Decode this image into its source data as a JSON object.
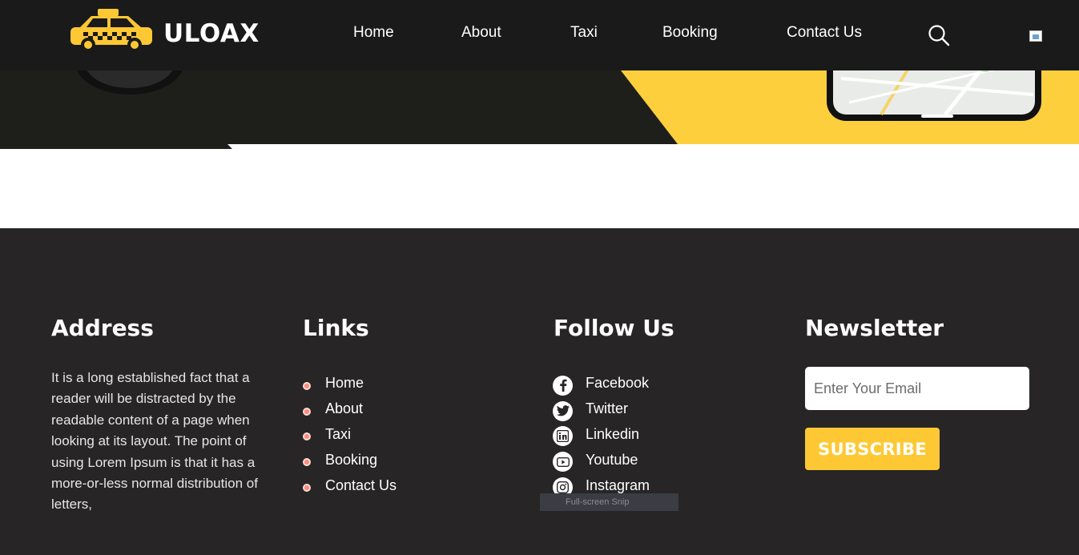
{
  "brand": {
    "name": "ULOAX",
    "logo_icon": "taxi-car-icon",
    "accent_color": "#fdc834"
  },
  "nav": {
    "items": [
      "Home",
      "About",
      "Taxi",
      "Booking",
      "Contact Us"
    ],
    "search_icon": "search-icon"
  },
  "footer": {
    "address": {
      "title": "Address",
      "text": "It is a long established fact that a reader will be distracted by the readable content of a page when looking at its layout. The point of using Lorem Ipsum is that it has a more-or-less normal distribution of letters,"
    },
    "links": {
      "title": "Links",
      "items": [
        "Home",
        "About",
        "Taxi",
        "Booking",
        "Contact Us"
      ]
    },
    "follow": {
      "title": "Follow Us",
      "items": [
        {
          "label": "Facebook",
          "icon": "facebook-icon"
        },
        {
          "label": "Twitter",
          "icon": "twitter-icon"
        },
        {
          "label": "Linkedin",
          "icon": "linkedin-icon"
        },
        {
          "label": "Youtube",
          "icon": "youtube-icon"
        },
        {
          "label": "Instagram",
          "icon": "instagram-icon"
        }
      ]
    },
    "newsletter": {
      "title": "Newsletter",
      "email_placeholder": "Enter Your Email",
      "email_value": "",
      "subscribe_label": "SUBSCRIBE"
    }
  },
  "overlay": {
    "snip_tooltip": "Full-screen Snip"
  },
  "colors": {
    "header_bg": "#1a1a1a",
    "footer_bg": "#272526",
    "bullet": "#ff8a7a"
  }
}
